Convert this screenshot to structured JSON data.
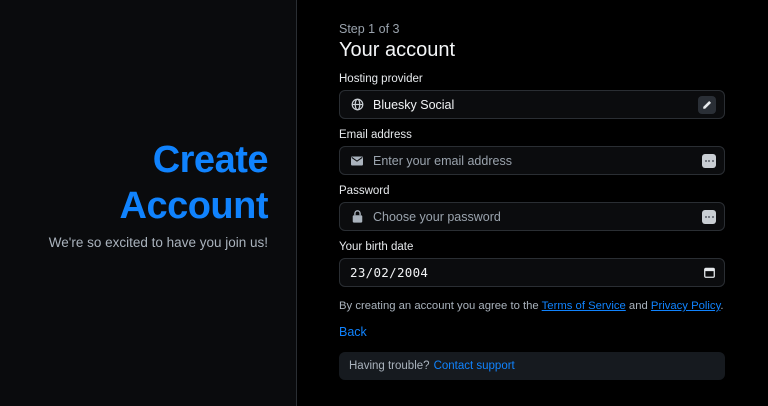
{
  "hero": {
    "title_line1": "Create",
    "title_line2": "Account",
    "subtitle": "We're so excited to have you join us!"
  },
  "form": {
    "step": "Step 1 of 3",
    "title": "Your account",
    "hosting": {
      "label": "Hosting provider",
      "value": "Bluesky Social",
      "icon": "globe-icon",
      "action_icon": "pencil-icon"
    },
    "email": {
      "label": "Email address",
      "placeholder": "Enter your email address",
      "icon": "envelope-icon"
    },
    "password": {
      "label": "Password",
      "placeholder": "Choose your password",
      "icon": "lock-icon"
    },
    "birth_date": {
      "label": "Your birth date",
      "value": "23/02/2004",
      "icon": "calendar-icon"
    },
    "terms": {
      "prefix": "By creating an account you agree to the ",
      "tos": "Terms of Service",
      "and": " and ",
      "privacy": "Privacy Policy",
      "suffix": "."
    },
    "back_label": "Back",
    "help": {
      "text": "Having trouble?",
      "link": "Contact support"
    }
  },
  "colors": {
    "accent": "#1083fe",
    "background": "#000000",
    "panel": "#0a0b0d",
    "border": "#2a2e33"
  }
}
